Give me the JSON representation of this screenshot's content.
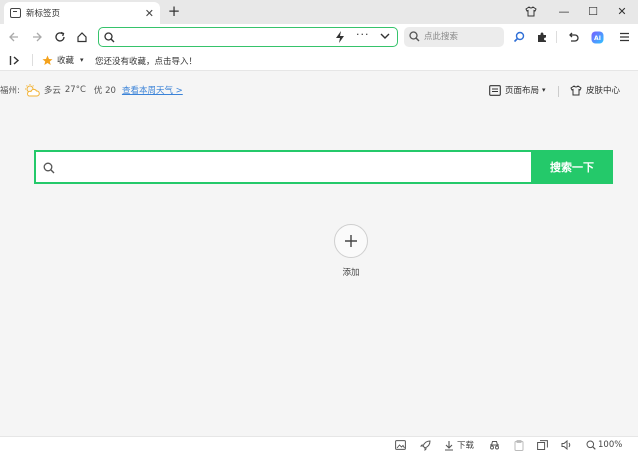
{
  "tab": {
    "title": "新标签页",
    "close": "✕"
  },
  "newtab": "+",
  "window": {
    "minimize": "—",
    "maximize": "☐",
    "close": "✕"
  },
  "search_engine_box": {
    "placeholder": "点此搜索"
  },
  "bookmarks": {
    "folder": "收藏",
    "empty_hint": "您还没有收藏，点击导入！"
  },
  "weather": {
    "city": "福州:",
    "condition": "多云",
    "temperature": "27°C",
    "aqi": "优 20",
    "link": "查看本周天气 >"
  },
  "toolbar_right": {
    "layout": "页面布局",
    "layout_caret": "▾",
    "skin": "皮肤中心"
  },
  "main_search": {
    "placeholder": "",
    "button": "搜索一下"
  },
  "add_shortcut": {
    "label": "添加"
  },
  "statusbar": {
    "download": "下载",
    "zoom": "100%"
  },
  "colors": {
    "accent": "#24c96a",
    "link": "#3b83d8",
    "star": "#f4a21c"
  }
}
